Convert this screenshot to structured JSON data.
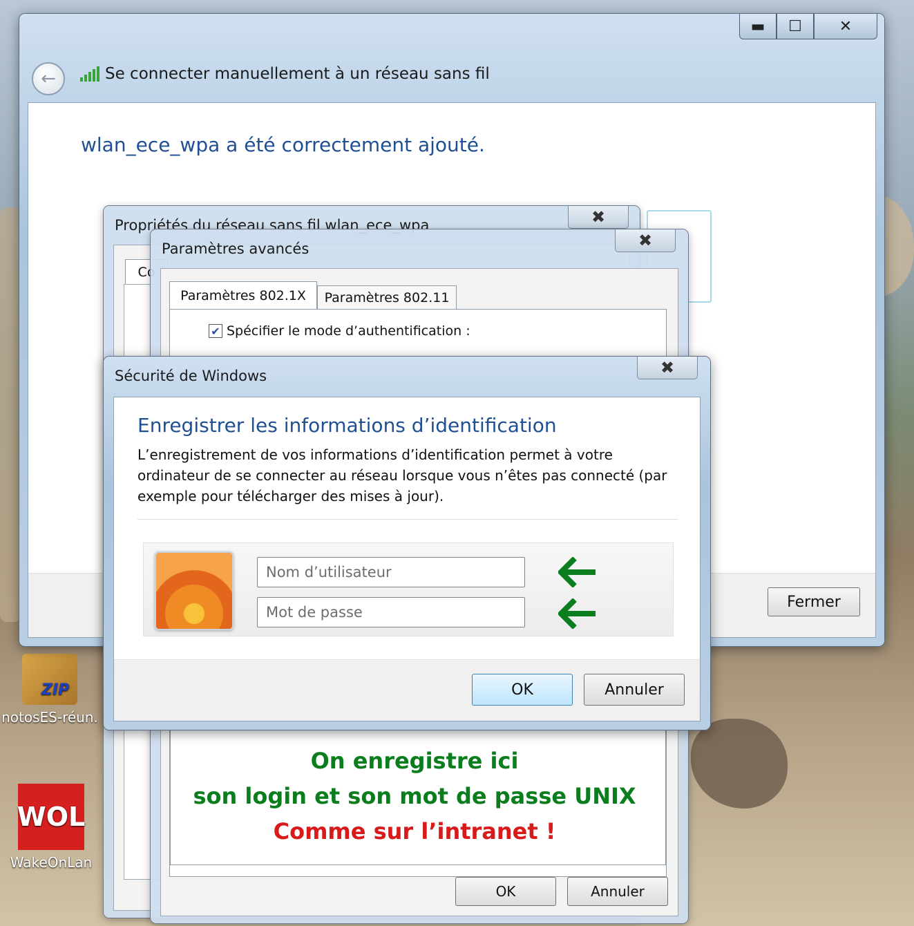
{
  "desktop": {
    "icons": [
      {
        "label": "notosES-réun.",
        "icon": "zip-archive-icon"
      },
      {
        "label": "WakeOnLan",
        "icon": "wol-app-icon"
      }
    ]
  },
  "wizard": {
    "title": "Se connecter manuellement à un réseau sans fil",
    "heading": "wlan_ece_wpa a été correctement ajouté.",
    "close_button": "Fermer",
    "caption": {
      "min": "▬",
      "max": "☐",
      "close": "✕"
    }
  },
  "properties_dialog": {
    "title": "Propriétés du réseau sans fil wlan_ece_wpa",
    "tab_partial": "Co",
    "close": "✖"
  },
  "advanced_dialog": {
    "title": "Paramètres avancés",
    "close": "✖",
    "tabs": [
      {
        "label": "Paramètres 802.1X",
        "active": true
      },
      {
        "label": "Paramètres 802.11",
        "active": false
      }
    ],
    "checkbox_label": "Spécifier le mode d’authentification :",
    "checkbox_checked": true,
    "ok_button": "OK",
    "cancel_button": "Annuler"
  },
  "security_dialog": {
    "title": "Sécurité de Windows",
    "close": "✖",
    "heading": "Enregistrer les informations d’identification",
    "description": "L’enregistrement de vos informations d’identification permet à votre ordinateur de se connecter au réseau lorsque vous n’êtes pas connecté (par exemple pour télécharger des mises à jour).",
    "username_placeholder": "Nom d’utilisateur",
    "password_placeholder": "Mot de passe",
    "ok_button": "OK",
    "cancel_button": "Annuler"
  },
  "annotation": {
    "line1": "On enregistre ici",
    "line2": "son login et son mot de passe UNIX",
    "line3": "Comme sur l’intranet !",
    "colors": {
      "green": "#0a7d1c",
      "red": "#d81a1a"
    }
  }
}
